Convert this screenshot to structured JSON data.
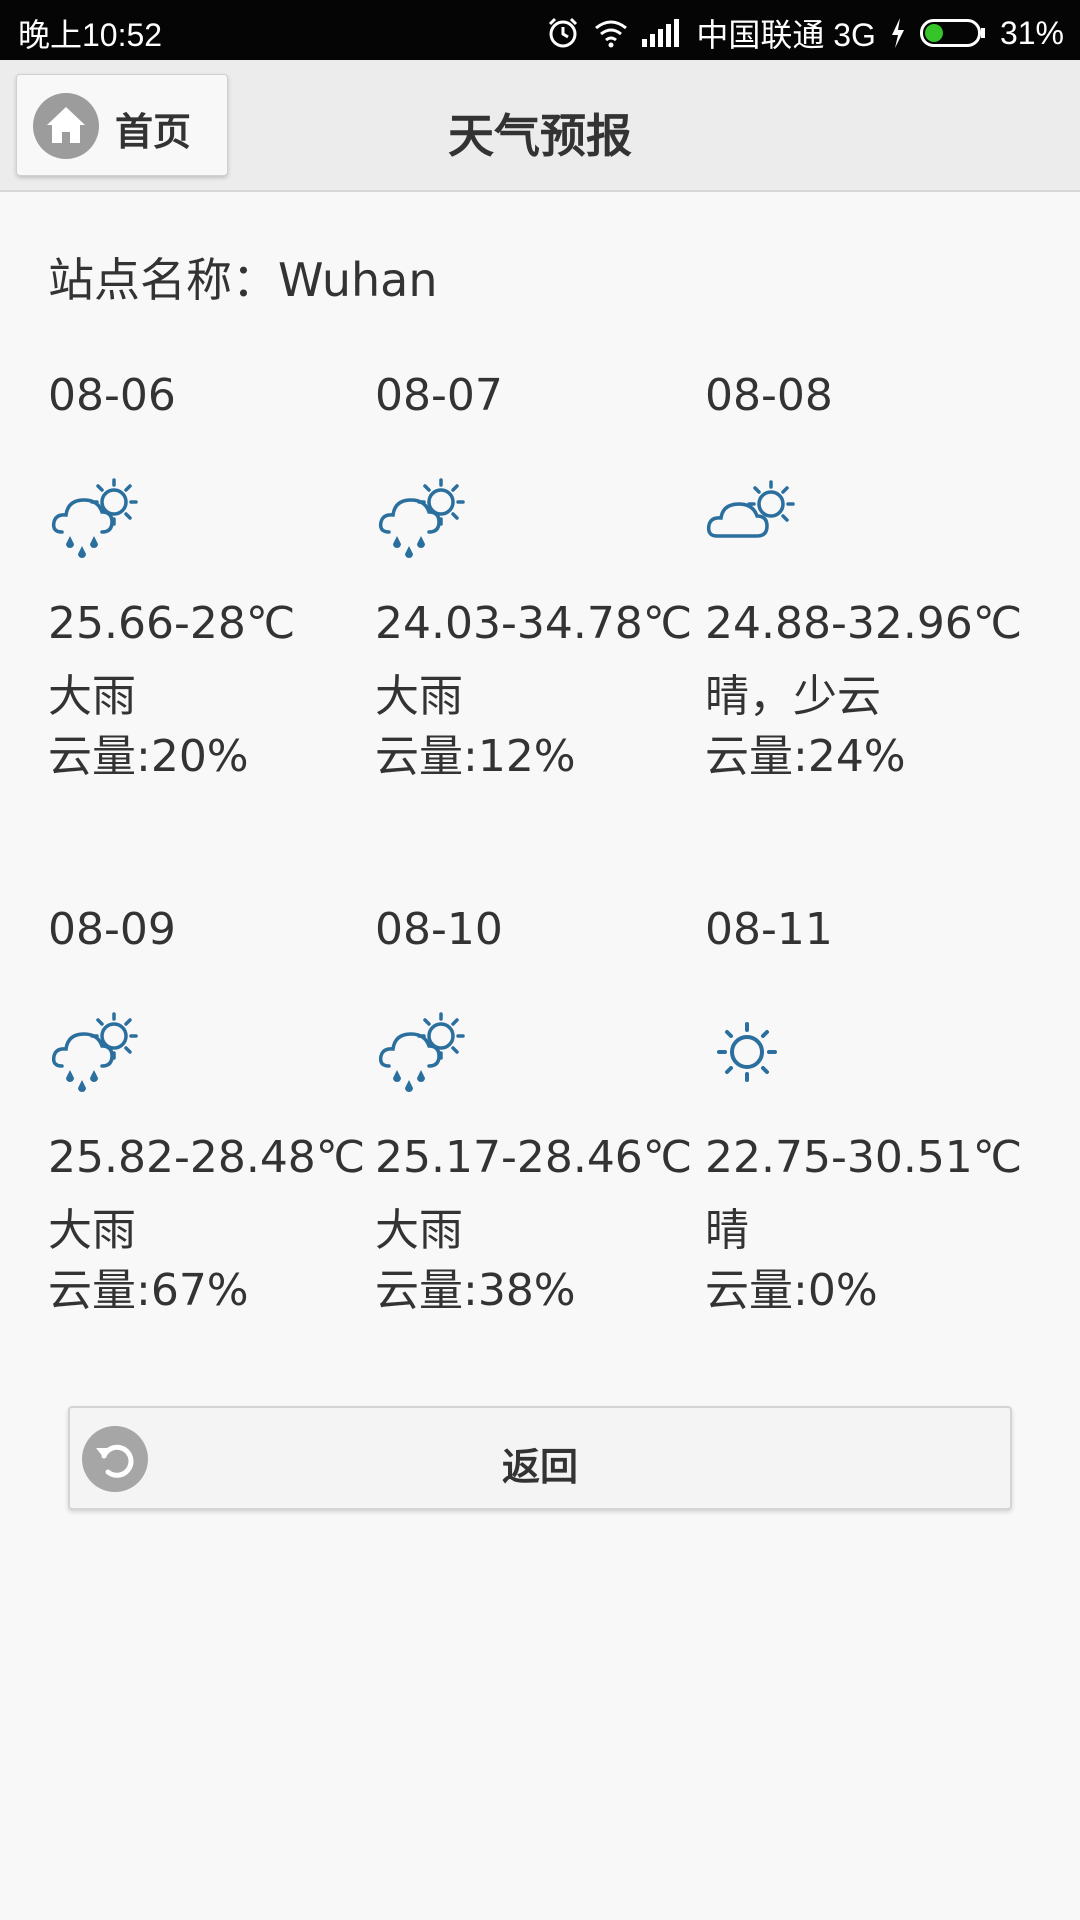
{
  "status_bar": {
    "time": "晚上10:52",
    "carrier": "中国联通 3G",
    "battery": "31%",
    "battery_level": 0.31,
    "icons": [
      "alarm-icon",
      "wifi-icon",
      "signal-icon",
      "charging-icon",
      "battery-icon"
    ]
  },
  "app_bar": {
    "home_label": "首页",
    "title": "天气预报"
  },
  "station": {
    "label": "站点名称：Wuhan"
  },
  "forecast": [
    {
      "date": "08-06",
      "icon": "rain-sun-icon",
      "temp": "25.66-28℃",
      "desc": "大雨",
      "cloud": "云量:20%"
    },
    {
      "date": "08-07",
      "icon": "rain-sun-icon",
      "temp": "24.03-34.78℃",
      "desc": "大雨",
      "cloud": "云量:12%"
    },
    {
      "date": "08-08",
      "icon": "cloud-sun-icon",
      "temp": "24.88-32.96℃",
      "desc": "晴，少云",
      "cloud": "云量:24%"
    },
    {
      "date": "08-09",
      "icon": "rain-sun-icon",
      "temp": "25.82-28.48℃",
      "desc": "大雨",
      "cloud": "云量:67%"
    },
    {
      "date": "08-10",
      "icon": "rain-sun-icon",
      "temp": "25.17-28.46℃",
      "desc": "大雨",
      "cloud": "云量:38%"
    },
    {
      "date": "08-11",
      "icon": "sun-icon",
      "temp": "22.75-30.51℃",
      "desc": "晴",
      "cloud": "云量:0%"
    }
  ],
  "back_button": {
    "label": "返回"
  },
  "colors": {
    "icon_blue": "#2a6f9e",
    "status_bg": "#050505",
    "battery_green": "#35c42a"
  }
}
